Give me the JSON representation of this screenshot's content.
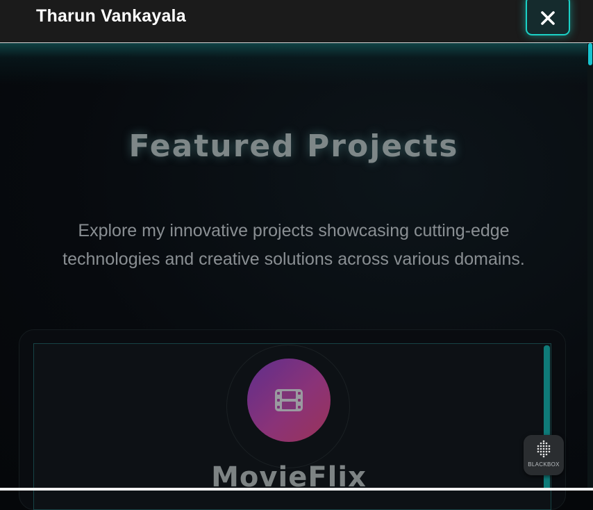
{
  "header": {
    "brand": "Tharun Vankayala",
    "close_icon": "close-icon"
  },
  "main": {
    "title": "Featured Projects",
    "subtitle": "Explore my innovative projects showcasing cutting-edge technologies and creative solutions across various domains."
  },
  "project_card": {
    "icon": "film-icon",
    "name": "MovieFlix"
  },
  "widget": {
    "label": "BLACKBOX",
    "icon": "blackbox-logo-icon"
  },
  "colors": {
    "accent": "#1bd1c6",
    "project_gradient_start": "#5f2e8c",
    "project_gradient_end": "#9a3358"
  }
}
